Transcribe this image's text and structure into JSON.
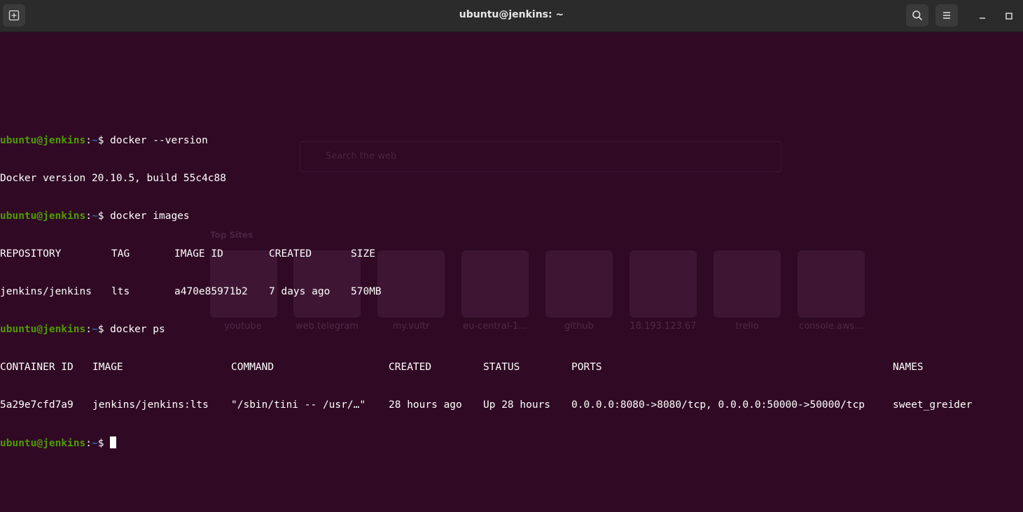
{
  "window": {
    "title": "ubuntu@jenkins: ~"
  },
  "icons": {
    "new_tab": "new-tab-icon",
    "search": "search-icon",
    "menu": "hamburger-menu-icon",
    "minimize": "minimize-icon",
    "maximize": "maximize-icon"
  },
  "prompt": {
    "user": "ubuntu@jenkins",
    "sep": ":",
    "path": "~",
    "symbol": "$ "
  },
  "commands": {
    "c1": "docker --version",
    "c1_out": "Docker version 20.10.5, build 55c4c88",
    "c2": "docker images",
    "c3": "docker ps"
  },
  "images_table": {
    "headers": [
      "REPOSITORY",
      "TAG",
      "IMAGE ID",
      "CREATED",
      "SIZE"
    ],
    "rows": [
      [
        "jenkins/jenkins",
        "lts",
        "a470e85971b2",
        "7 days ago",
        "570MB"
      ]
    ]
  },
  "ps_table": {
    "headers": [
      "CONTAINER ID",
      "IMAGE",
      "COMMAND",
      "CREATED",
      "STATUS",
      "PORTS",
      "NAMES"
    ],
    "rows": [
      [
        "5a29e7cfd7a9",
        "jenkins/jenkins:lts",
        "\"/sbin/tini -- /usr/…\"",
        "28 hours ago",
        "Up 28 hours",
        "0.0.0.0:8080->8080/tcp, 0.0.0.0:50000->50000/tcp",
        "sweet_greider"
      ]
    ]
  },
  "background": {
    "search_placeholder": "Search the web",
    "top_sites_label": "Top Sites",
    "tiles": [
      "youtube",
      "web.telegram",
      "my.vultr",
      "eu-central-1...",
      "github",
      "18.193.123.67",
      "trello",
      "console.aws..."
    ]
  },
  "colors": {
    "terminal_bg": "#300a24",
    "prompt_user": "#4e9a06",
    "prompt_path": "#3465a4",
    "titlebar": "#2b2b2b"
  }
}
